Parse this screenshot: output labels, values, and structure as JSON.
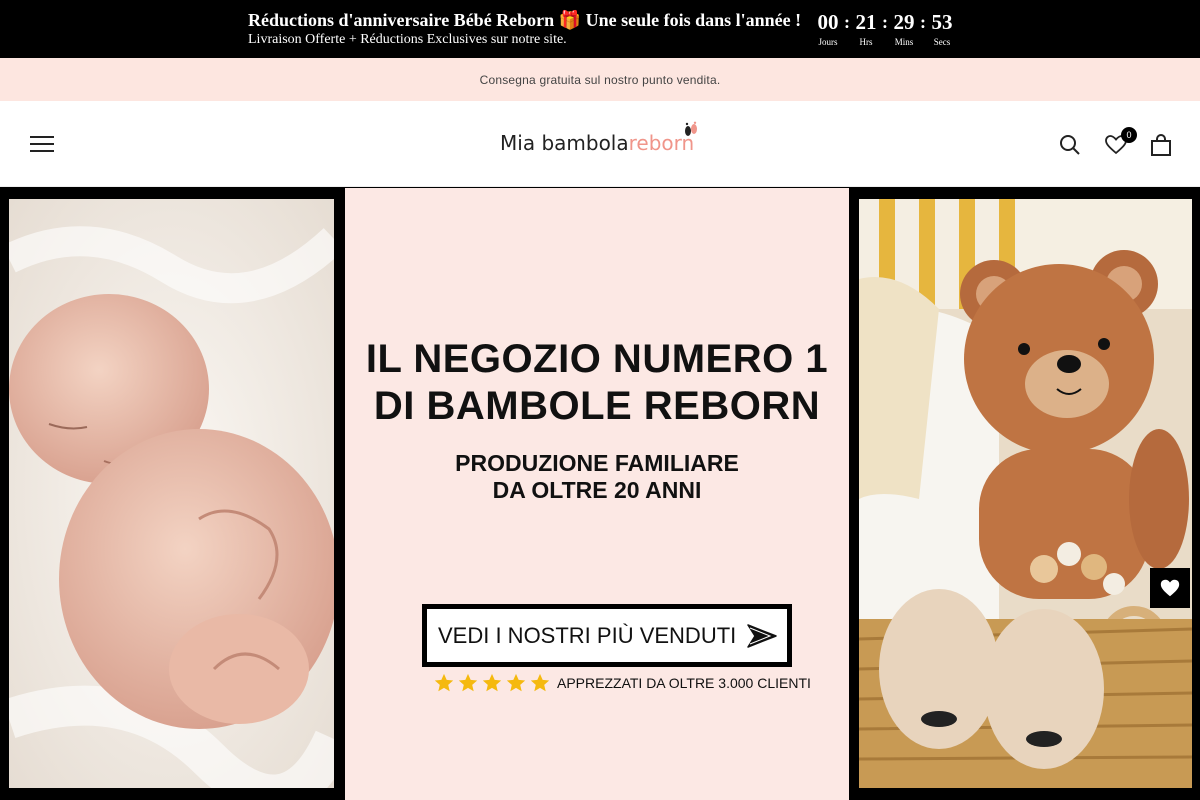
{
  "announcement": {
    "title": "Réductions d'anniversaire Bébé Reborn 🎁 Une seule fois dans l'année !",
    "subtitle": "Livraison Offerte + Réductions Exclusives sur notre site.",
    "countdown": [
      {
        "value": "00",
        "label": "Jours"
      },
      {
        "value": "21",
        "label": "Hrs"
      },
      {
        "value": "29",
        "label": "Mins"
      },
      {
        "value": "53",
        "label": "Secs"
      }
    ],
    "separator": ":"
  },
  "shipping_bar": {
    "text": "Consegna gratuita sul nostro punto vendita."
  },
  "header": {
    "logo": {
      "word1": "Mia",
      "word2": "bambola",
      "word3": "reborn"
    },
    "icons": {
      "menu": "hamburger-menu-icon",
      "search": "search-icon",
      "wishlist": "heart-icon",
      "cart": "shopping-bag-icon"
    },
    "wishlist_count": "0"
  },
  "hero": {
    "title_line1": "IL NEGOZIO NUMERO 1",
    "title_line2": "DI BAMBOLE REBORN",
    "subtitle_line1": "PRODUZIONE FAMILIARE",
    "subtitle_line2": "DA OLTRE 20 ANNI",
    "cta_label": "VEDI I NOSTRI PIÙ VENDUTI",
    "rating_stars": 5,
    "rating_text": "APPREZZATI DA OLTRE 3.000 CLIENTI"
  },
  "colors": {
    "announcement_bg": "#000000",
    "shipping_bg": "#fde6e0",
    "hero_center_bg": "#fce8e4",
    "logo_accent": "#f0958a",
    "star": "#f5b90f"
  }
}
